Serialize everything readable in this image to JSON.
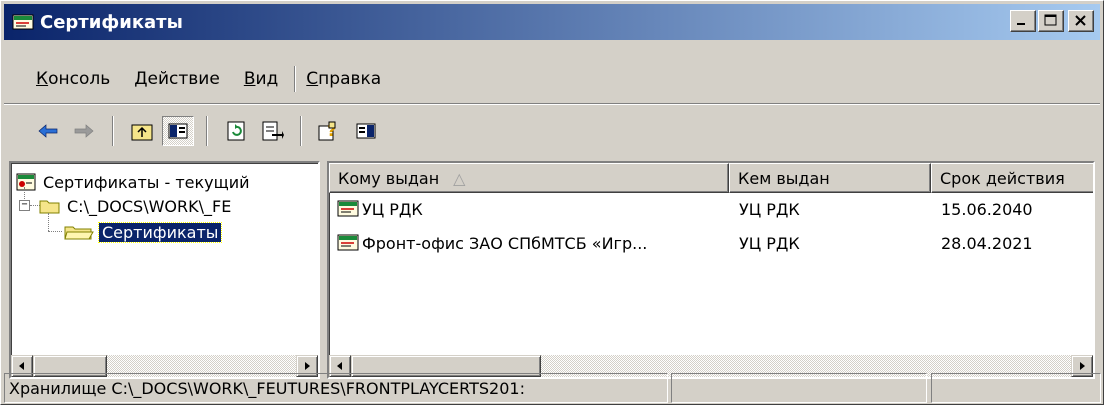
{
  "window": {
    "title": "Сертификаты",
    "minimize": "_",
    "maximize": "□",
    "close": "✕"
  },
  "menu": {
    "items": [
      {
        "hot": "К",
        "rest": "онсоль"
      },
      {
        "hot": "Д",
        "rest": "ействие"
      },
      {
        "hot": "В",
        "rest": "ид"
      },
      {
        "hot": "С",
        "rest": "правка"
      }
    ]
  },
  "toolbar": {
    "icons": [
      "back-arrow-icon",
      "forward-arrow-icon",
      "up-folder-icon",
      "show-hide-tree-icon",
      "refresh-icon",
      "export-list-icon",
      "help-icon",
      "show-hide-action-pane-icon"
    ]
  },
  "tree": {
    "root": "Сертификаты - текущий",
    "child": "C:\\_DOCS\\WORK\\_FE",
    "leaf": "Сертификаты"
  },
  "list": {
    "columns": [
      "Кому выдан",
      "Кем выдан",
      "Срок действия"
    ],
    "sort_indicator": "△",
    "rows": [
      {
        "issued_to": "УЦ РДК",
        "issued_by": "УЦ РДК",
        "expires": "15.06.2040"
      },
      {
        "issued_to": "Фронт-офис ЗАО СПбМТСБ «Игр...",
        "issued_by": "УЦ РДК",
        "expires": "28.04.2021"
      }
    ]
  },
  "status": {
    "text": "Хранилище C:\\_DOCS\\WORK\\_FEUTURES\\FRONTPLAYCERTS201:",
    "panel2": "",
    "panel3": ""
  },
  "colors": {
    "title_start": "#0a246a",
    "title_end": "#a6caf0",
    "face": "#d4d0c8",
    "selection": "#0a246a"
  }
}
